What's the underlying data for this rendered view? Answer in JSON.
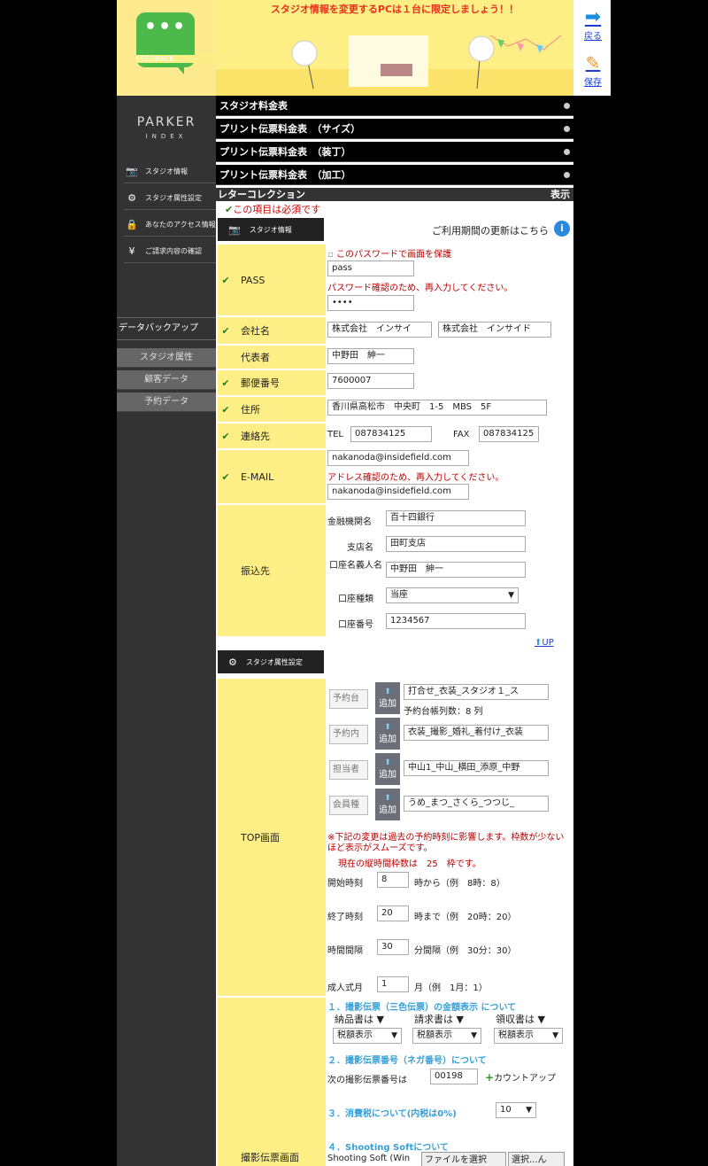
{
  "feedback": {
    "label": "FEEDBACK"
  },
  "brand": {
    "line1": "PARKER",
    "line2": "INDEX"
  },
  "sidebar": {
    "items": [
      {
        "label": "スタジオ情報"
      },
      {
        "label": "スタジオ属性設定"
      },
      {
        "label": "あなたのアクセス情報"
      },
      {
        "label": "ご請求内容の確認"
      }
    ],
    "backup": "データバックアップ",
    "buttons": [
      "スタジオ属性",
      "顧客データ",
      "予約データ"
    ]
  },
  "banner": {
    "message": "スタジオ情報を変更するPCは１台に限定しましょう！！"
  },
  "right": {
    "back": "戻る",
    "save": "保存"
  },
  "accordions": [
    "スタジオ料金表",
    "プリント伝票料金表　（サイズ）",
    "プリント伝票料金表　（装丁）",
    "プリント伝票料金表　（加工）"
  ],
  "letter": {
    "title": "レターコレクション",
    "show": "表示"
  },
  "required_note": "この項目は必須です",
  "section1": {
    "title": "スタジオ情報",
    "update_link": "ご利用期間の更新はこちら"
  },
  "pass": {
    "label": "PASS",
    "protect": "このパスワードで画面を保護",
    "value": "pass",
    "confirm_note": "パスワード確認のため、再入力してください。",
    "confirm_value": "••••"
  },
  "company": {
    "label": "会社名",
    "value1": "株式会社　インサイ",
    "value2": "株式会社　インサイド"
  },
  "rep": {
    "label": "代表者",
    "value": "中野田　紳一"
  },
  "zip": {
    "label": "郵便番号",
    "value": "7600007"
  },
  "address": {
    "label": "住所",
    "value": "香川県高松市　中央町　1-5　MBS　5F"
  },
  "contact": {
    "label": "連絡先",
    "tel_label": "TEL",
    "tel": "087834125",
    "fax_label": "FAX",
    "fax": "087834125"
  },
  "email": {
    "label": "E-MAIL",
    "value": "nakanoda@insidefield.com",
    "confirm_note": "アドレス確認のため、再入力してください。",
    "confirm_value": "nakanoda@insidefield.com"
  },
  "bank": {
    "label": "振込先",
    "bank_label": "金融機関名",
    "bank_value": "百十四銀行",
    "branch_label": "支店名",
    "branch_value": "田町支店",
    "holder_label": "口座名義人名",
    "holder_value": "中野田　紳一",
    "type_label": "口座種類",
    "type_value": "当座",
    "number_label": "口座番号",
    "number_value": "1234567"
  },
  "up_link": "UP",
  "section2": {
    "title": "スタジオ属性設定"
  },
  "top": {
    "label": "TOP画面",
    "rows": [
      {
        "btn": "予約台",
        "value": "打合せ_衣装_スタジオ１_ス"
      },
      {
        "btn": "予約内",
        "value": "衣装_撮影_婚礼_着付け_衣装"
      },
      {
        "btn": "担当者",
        "value": "中山1_中山_横田_添原_中野"
      },
      {
        "btn": "会員種",
        "value": "うめ_まつ_さくら_つつじ_"
      }
    ],
    "add": "追加",
    "count_note": "予約台帳列数：8 列",
    "warn": "※下記の変更は過去の予約時刻に影響します。枠数が少ないほど表示がスムーズです。",
    "current": "現在の縦時間枠数は　25　枠です。",
    "start_label": "開始時刻",
    "start_value": "8",
    "start_hint": "時から（例　8時：8）",
    "end_label": "終了時刻",
    "end_value": "20",
    "end_hint": "時まで（例　20時：20）",
    "interval_label": "時間間隔",
    "interval_value": "30",
    "interval_hint": "分間隔（例　30分：30）",
    "coming_label": "成人式月",
    "coming_value": "1",
    "coming_hint": "月（例　1月：1）"
  },
  "shoot": {
    "label": "撮影伝票画面",
    "h1": "１．撮影伝票（三色伝票）の金額表示 について",
    "col1": "納品書は ▼",
    "col2": "請求書は ▼",
    "col3": "領収書は ▼",
    "sel1": "税額表示",
    "sel2": "税額表示",
    "sel3": "税額表示",
    "h2": "２．撮影伝票番号（ネガ番号）について",
    "next_label": "次の撮影伝票番号は",
    "next_value": "00198",
    "countup": "カウントアップ",
    "h3": "３．消費税について(内税は0%)",
    "tax_value": "10",
    "h4": "４．Shooting Softについて",
    "soft_label": "Shooting Soft (Win",
    "file_btn": "ファイルを選択",
    "file_text": "選択...ん"
  }
}
